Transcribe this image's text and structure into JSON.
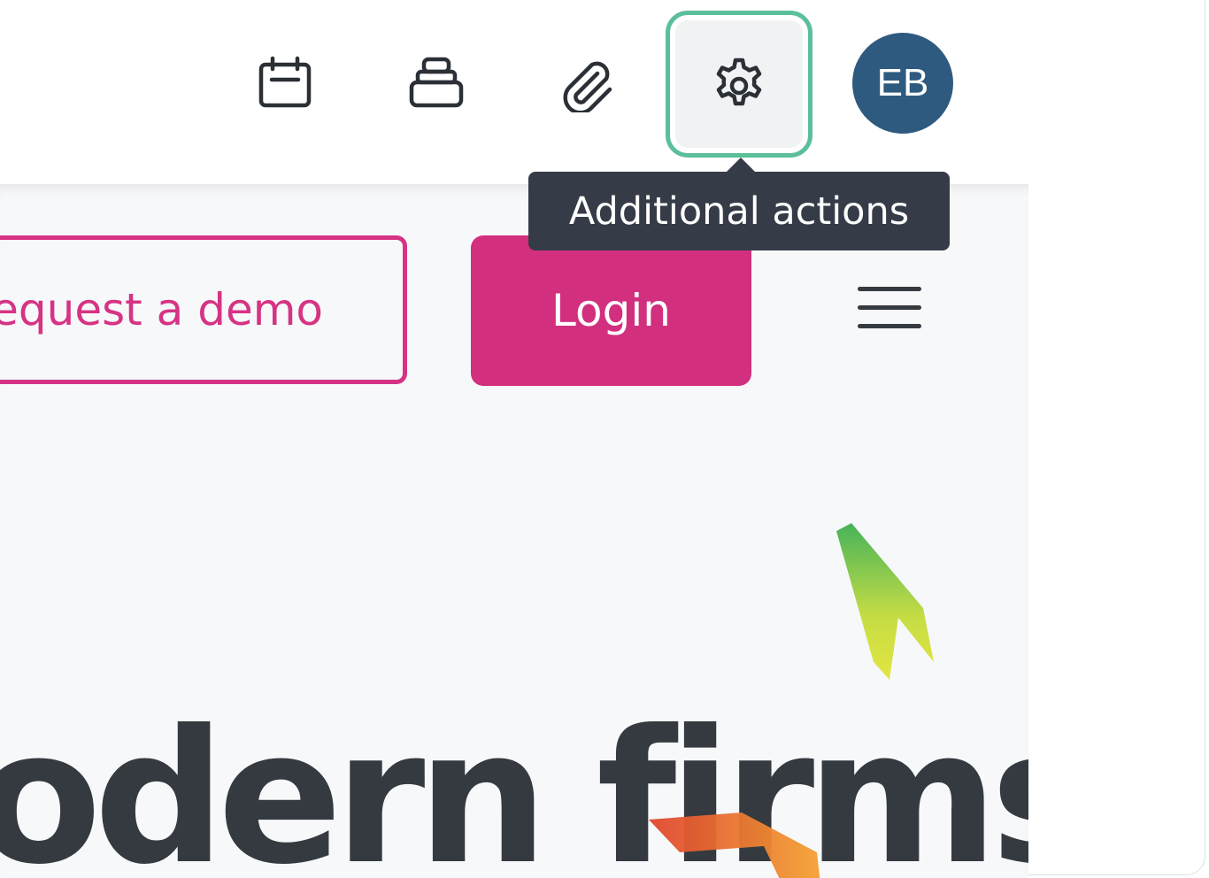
{
  "toolbar": {
    "icons": [
      {
        "name": "calendar-icon"
      },
      {
        "name": "stamp-icon"
      },
      {
        "name": "paperclip-icon"
      },
      {
        "name": "gear-icon",
        "active": true
      }
    ],
    "avatar_initials": "EB",
    "avatar_color": "#2e5a80",
    "active_outline_color": "#5bbf9a"
  },
  "tooltip": {
    "text": "Additional actions"
  },
  "preview": {
    "request_demo_label": "Request a demo",
    "login_label": "Login",
    "menu_icon": "hamburger-icon",
    "headline_text": "odern firms",
    "brand_color": "#d22f7f"
  }
}
